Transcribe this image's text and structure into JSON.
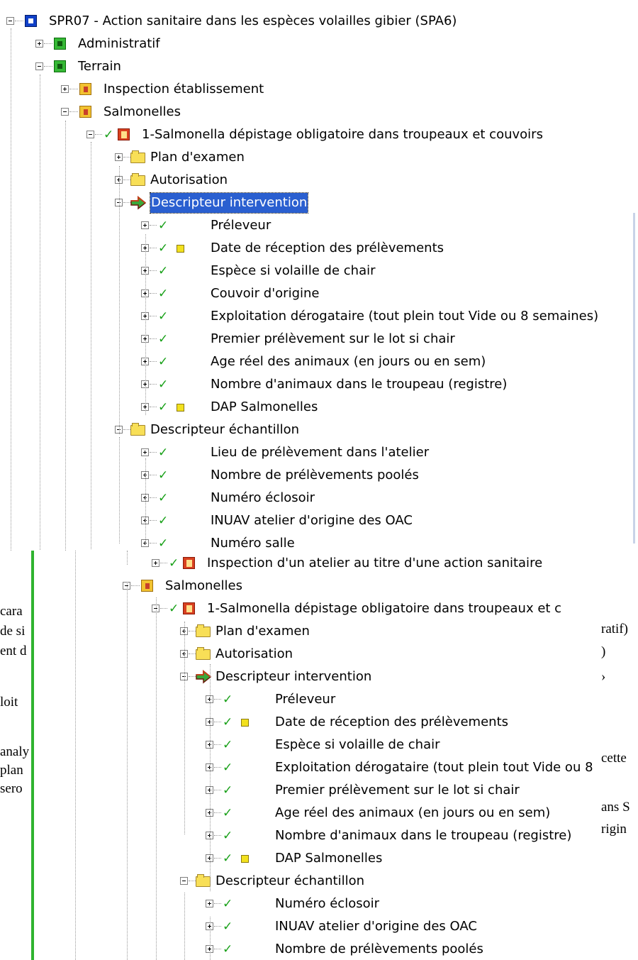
{
  "top_tree": [
    {
      "label": "SPR07 - Action sanitaire dans les espèces volailles gibier (SPA6)",
      "level": 0,
      "icon": "p-icon",
      "exp": "minus"
    },
    {
      "label": "Administratif",
      "level": 1,
      "icon": "d-icon",
      "exp": "plus"
    },
    {
      "label": "Terrain",
      "level": 1,
      "icon": "d-icon",
      "exp": "minus"
    },
    {
      "label": "Inspection établissement",
      "level": 2,
      "icon": "e-icon",
      "exp": "plus"
    },
    {
      "label": "Salmonelles",
      "level": 2,
      "icon": "e-icon",
      "exp": "minus"
    },
    {
      "label": "1-Salmonella  dépistage obligatoire  dans troupeaux et couvoirs",
      "level": 3,
      "icon": "a-icon",
      "exp": "minus",
      "check": true
    },
    {
      "label": "Plan d'examen",
      "level": 4,
      "icon": "folder-icon",
      "exp": "plus"
    },
    {
      "label": "Autorisation",
      "level": 4,
      "icon": "folder-icon",
      "exp": "plus"
    },
    {
      "label": "Descripteur intervention",
      "level": 4,
      "icon": "arrow-icon",
      "exp": "minus",
      "selected": true
    },
    {
      "label": "Préleveur",
      "level": 5,
      "exp": "plus",
      "check": true
    },
    {
      "label": "Date de réception des prélèvements",
      "level": 5,
      "exp": "plus",
      "check": true,
      "note": true
    },
    {
      "label": "Espèce si volaille de chair",
      "level": 5,
      "exp": "plus",
      "check": true
    },
    {
      "label": "Couvoir d'origine",
      "level": 5,
      "exp": "plus",
      "check": true
    },
    {
      "label": "Exploitation dérogataire (tout plein tout Vide ou 8 semaines)",
      "level": 5,
      "exp": "plus",
      "check": true
    },
    {
      "label": "Premier prélèvement sur le lot si chair",
      "level": 5,
      "exp": "plus",
      "check": true
    },
    {
      "label": "Age réel des animaux (en jours ou en sem)",
      "level": 5,
      "exp": "plus",
      "check": true
    },
    {
      "label": "Nombre d'animaux dans le troupeau (registre)",
      "level": 5,
      "exp": "plus",
      "check": true
    },
    {
      "label": "DAP Salmonelles",
      "level": 5,
      "exp": "plus",
      "check": true,
      "note": true
    },
    {
      "label": "Descripteur échantillon",
      "level": 4,
      "icon": "folder-icon",
      "exp": "minus"
    },
    {
      "label": "Lieu de prélèvement dans l'atelier",
      "level": 5,
      "exp": "plus",
      "check": true
    },
    {
      "label": "Nombre de prélèvements poolés",
      "level": 5,
      "exp": "plus",
      "check": true
    },
    {
      "label": "Numéro  éclosoir",
      "level": 5,
      "exp": "plus",
      "check": true
    },
    {
      "label": "INUAV atelier d'origine des OAC",
      "level": 5,
      "exp": "plus",
      "check": true
    },
    {
      "label": "Numéro salle",
      "level": 5,
      "exp": "plus",
      "check": true
    }
  ],
  "bottom_tree": [
    {
      "label": "Inspection d'un atelier au titre d'une action sanitaire",
      "level": 3,
      "icon": "a-icon",
      "exp": "plus",
      "check": true
    },
    {
      "label": "Salmonelles",
      "level": 2,
      "icon": "e-icon",
      "exp": "minus"
    },
    {
      "label": "1-Salmonella  dépistage obligatoire  dans troupeaux et c",
      "level": 3,
      "icon": "a-icon",
      "exp": "minus",
      "check": true
    },
    {
      "label": "Plan d'examen",
      "level": 4,
      "icon": "folder-icon",
      "exp": "plus"
    },
    {
      "label": "Autorisation",
      "level": 4,
      "icon": "folder-icon",
      "exp": "plus"
    },
    {
      "label": "Descripteur intervention",
      "level": 4,
      "icon": "arrow-icon",
      "exp": "minus"
    },
    {
      "label": "Préleveur",
      "level": 5,
      "exp": "plus",
      "check": true
    },
    {
      "label": "Date de réception des prélèvements",
      "level": 5,
      "exp": "plus",
      "check": true,
      "note": true
    },
    {
      "label": "Espèce si volaille de chair",
      "level": 5,
      "exp": "plus",
      "check": true
    },
    {
      "label": "Exploitation dérogataire (tout plein tout Vide ou 8",
      "level": 5,
      "exp": "plus",
      "check": true
    },
    {
      "label": "Premier prélèvement sur le lot si chair",
      "level": 5,
      "exp": "plus",
      "check": true
    },
    {
      "label": "Age réel des animaux (en jours ou en sem)",
      "level": 5,
      "exp": "plus",
      "check": true
    },
    {
      "label": "Nombre d'animaux dans le troupeau (registre)",
      "level": 5,
      "exp": "plus",
      "check": true
    },
    {
      "label": "DAP Salmonelles",
      "level": 5,
      "exp": "plus",
      "check": true,
      "note": true
    },
    {
      "label": "Descripteur échantillon",
      "level": 4,
      "icon": "folder-icon",
      "exp": "minus"
    },
    {
      "label": "Numéro  éclosoir",
      "level": 5,
      "exp": "plus",
      "check": true
    },
    {
      "label": "INUAV atelier d'origine des OAC",
      "level": 5,
      "exp": "plus",
      "check": true
    },
    {
      "label": "Nombre de prélèvements poolés",
      "level": 5,
      "exp": "plus",
      "check": true
    }
  ],
  "doc_fragments": {
    "left": [
      "cara",
      "de si",
      "ent d",
      "loit",
      "analy",
      "plan",
      "sero"
    ],
    "right": [
      "ratif)",
      ")",
      "›",
      "cette",
      "ans S",
      "rigin"
    ]
  },
  "check_glyph": "✓"
}
